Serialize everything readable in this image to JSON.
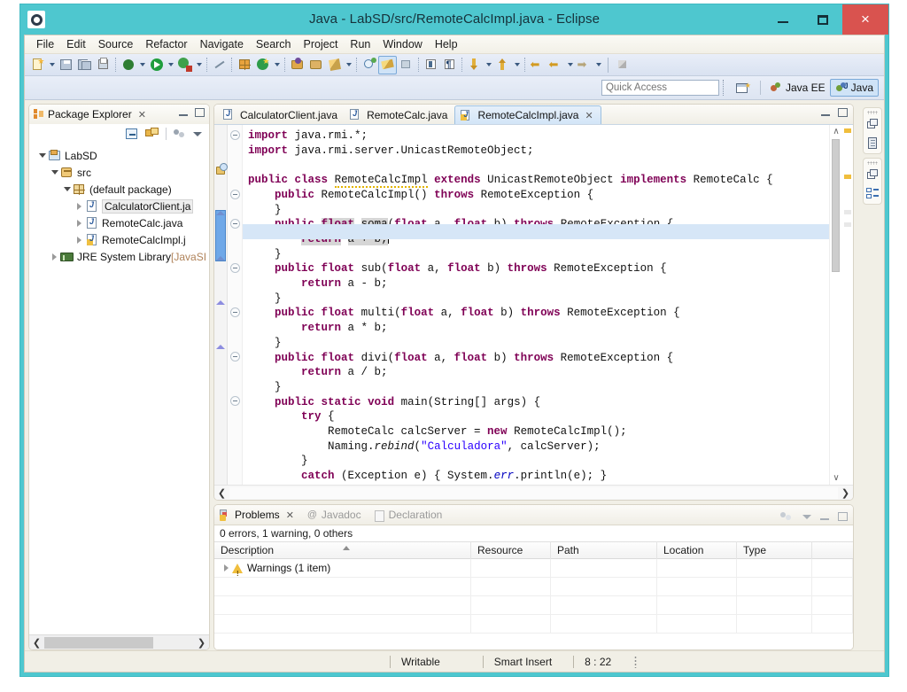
{
  "window": {
    "title": "Java - LabSD/src/RemoteCalcImpl.java - Eclipse",
    "logo_icon": "eclipse-logo-icon",
    "minimize_label": "Minimize",
    "maximize_label": "Maximize",
    "close_label": "×"
  },
  "menubar": {
    "items": [
      {
        "label": "File",
        "mnemonic": "F"
      },
      {
        "label": "Edit",
        "mnemonic": "E"
      },
      {
        "label": "Source",
        "mnemonic": "S"
      },
      {
        "label": "Refactor",
        "mnemonic": "t"
      },
      {
        "label": "Navigate",
        "mnemonic": "N"
      },
      {
        "label": "Search",
        "mnemonic": "a"
      },
      {
        "label": "Project",
        "mnemonic": "P"
      },
      {
        "label": "Run",
        "mnemonic": "R"
      },
      {
        "label": "Window",
        "mnemonic": "W"
      },
      {
        "label": "Help",
        "mnemonic": "H"
      }
    ]
  },
  "toolbar": {
    "items": [
      {
        "name": "new-wizard-button",
        "icon": "new-document-icon",
        "dropdown": true
      },
      {
        "name": "save-button",
        "icon": "save-icon",
        "dropdown": false
      },
      {
        "name": "save-all-button",
        "icon": "save-all-icon",
        "dropdown": false
      },
      {
        "name": "print-button",
        "icon": "print-icon",
        "dropdown": false
      },
      {
        "name": "debug-button",
        "icon": "debug-bug-icon",
        "dropdown": true
      },
      {
        "name": "run-button",
        "icon": "run-play-icon",
        "dropdown": true
      },
      {
        "name": "coverage-button",
        "icon": "coverage-icon",
        "dropdown": true
      },
      {
        "name": "skip-breakpoints-button",
        "icon": "skip-breakpoints-icon",
        "dropdown": false
      },
      {
        "name": "new-java-project-button",
        "icon": "new-java-project-icon",
        "dropdown": false
      },
      {
        "name": "new-class-button",
        "icon": "new-class-icon",
        "dropdown": true
      },
      {
        "name": "open-type-button",
        "icon": "open-type-icon",
        "dropdown": false
      },
      {
        "name": "open-task-button",
        "icon": "open-task-icon",
        "dropdown": false
      },
      {
        "name": "quick-fix-button",
        "icon": "quick-fix-pencil-icon",
        "dropdown": true
      },
      {
        "name": "search-button",
        "icon": "search-globe-icon",
        "dropdown": false
      },
      {
        "name": "toggle-mark-occurrences-button",
        "icon": "highlighter-icon",
        "dropdown": false,
        "selected": true
      },
      {
        "name": "link-editor-button",
        "icon": "link-editor-icon",
        "dropdown": false
      },
      {
        "name": "toggle-block-selection-button",
        "icon": "block-selection-icon",
        "dropdown": false
      },
      {
        "name": "show-whitespace-button",
        "icon": "pilcrow-icon",
        "dropdown": false
      },
      {
        "name": "next-annotation-button",
        "icon": "next-annotation-icon",
        "dropdown": true
      },
      {
        "name": "previous-annotation-button",
        "icon": "previous-annotation-icon",
        "dropdown": true
      },
      {
        "name": "back-button",
        "icon": "back-arrow-icon",
        "dropdown": false
      },
      {
        "name": "forward-button",
        "icon": "forward-arrow-icon",
        "dropdown": true
      },
      {
        "name": "next-edit-button",
        "icon": "next-edit-arrow-icon",
        "dropdown": true
      },
      {
        "name": "pin-editor-button",
        "icon": "pin-editor-icon",
        "dropdown": false
      }
    ]
  },
  "quick_access": {
    "placeholder": "Quick Access",
    "value": "",
    "new_perspective_label": "Open Perspective",
    "perspectives": [
      {
        "label": "Java EE",
        "active": false,
        "icon": "java-ee-perspective-icon"
      },
      {
        "label": "Java",
        "active": true,
        "icon": "java-perspective-icon"
      }
    ]
  },
  "package_explorer": {
    "title": "Package Explorer",
    "close_glyph": "✕",
    "icon": "package-explorer-icon",
    "toolbar": [
      {
        "name": "collapse-all-button",
        "icon": "collapse-all-icon"
      },
      {
        "name": "link-with-editor-button",
        "icon": "link-with-editor-icon"
      },
      {
        "name": "focus-on-active-task-button",
        "icon": "focus-active-task-icon"
      },
      {
        "name": "view-menu-button",
        "icon": "view-menu-chevron-icon"
      }
    ],
    "minimize_label": "Minimize",
    "maximize_label": "Maximize",
    "tree": [
      {
        "label": "LabSD",
        "indent": 0,
        "twisty": "open",
        "icon": "java-project-icon",
        "selected": false
      },
      {
        "label": "src",
        "indent": 1,
        "twisty": "open",
        "icon": "source-folder-icon",
        "selected": false
      },
      {
        "label": "(default package)",
        "indent": 2,
        "twisty": "open",
        "icon": "package-icon",
        "selected": false
      },
      {
        "label": "CalculatorClient.ja",
        "indent": 3,
        "twisty": "closed",
        "icon": "java-file-icon",
        "selected": true
      },
      {
        "label": "RemoteCalc.java",
        "indent": 3,
        "twisty": "closed",
        "icon": "java-file-icon",
        "selected": false
      },
      {
        "label": "RemoteCalcImpl.j",
        "indent": 3,
        "twisty": "closed",
        "icon": "java-file-warning-icon",
        "selected": false
      },
      {
        "label": "JRE System Library ",
        "sublabel": "[JavaSI",
        "indent": 1,
        "twisty": "closed",
        "icon": "jre-library-icon",
        "selected": false
      }
    ],
    "hscroll": {
      "left_glyph": "❮",
      "right_glyph": "❯"
    }
  },
  "editor": {
    "tabs": [
      {
        "label": "CalculatorClient.java",
        "active": false,
        "icon": "java-file-icon",
        "closeable": false
      },
      {
        "label": "RemoteCalc.java",
        "active": false,
        "icon": "java-file-icon",
        "closeable": false
      },
      {
        "label": "RemoteCalcImpl.java",
        "active": true,
        "icon": "java-file-warning-icon",
        "closeable": true,
        "close_glyph": "✕"
      }
    ],
    "minimize_label": "Minimize",
    "maximize_label": "Maximize",
    "scroll_up_glyph": "∧",
    "scroll_down_glyph": "∨",
    "hscroll": {
      "left_glyph": "❮",
      "right_glyph": "❯"
    },
    "code_lines": [
      "import java.rmi.*;",
      "import java.rmi.server.UnicastRemoteObject;",
      "",
      "public class RemoteCalcImpl extends UnicastRemoteObject implements RemoteCalc {",
      "    public RemoteCalcImpl() throws RemoteException {",
      "    }",
      "    public float soma(float a, float b) throws RemoteException {",
      "        return a + b;",
      "    }",
      "    public float sub(float a, float b) throws RemoteException {",
      "        return a - b;",
      "    }",
      "    public float multi(float a, float b) throws RemoteException {",
      "        return a * b;",
      "    }",
      "    public float divi(float a, float b) throws RemoteException {",
      "        return a / b;",
      "    }",
      "    public static void main(String[] args) {",
      "        try {",
      "            RemoteCalc calcServer = new RemoteCalcImpl();",
      "            Naming.rebind(\"Calculadora\", calcServer);",
      "        }",
      "        catch (Exception e) { System.err.println(e); }",
      "    }"
    ]
  },
  "problems": {
    "tabs": [
      {
        "label": "Problems",
        "active": true,
        "icon": "problems-icon",
        "closeable": true,
        "close_glyph": "✕"
      },
      {
        "label": "Javadoc",
        "active": false,
        "icon": "javadoc-icon",
        "closeable": false
      },
      {
        "label": "Declaration",
        "active": false,
        "icon": "declaration-icon",
        "closeable": false
      }
    ],
    "toolbar": [
      {
        "name": "filters-button",
        "icon": "filters-icon"
      },
      {
        "name": "view-menu-button",
        "icon": "view-menu-chevron-icon"
      },
      {
        "name": "minimize-button",
        "icon": "minimize-icon"
      },
      {
        "name": "maximize-button",
        "icon": "maximize-icon"
      }
    ],
    "summary": "0 errors, 1 warning, 0 others",
    "columns": [
      "Description",
      "Resource",
      "Path",
      "Location",
      "Type"
    ],
    "rows": [
      {
        "description": "Warnings (1 item)",
        "icon": "warning-icon",
        "twisty": "closed",
        "resource": "",
        "path": "",
        "location": "",
        "type": ""
      },
      {
        "description": "",
        "icon": "",
        "twisty": "",
        "resource": "",
        "path": "",
        "location": "",
        "type": ""
      },
      {
        "description": "",
        "icon": "",
        "twisty": "",
        "resource": "",
        "path": "",
        "location": "",
        "type": ""
      },
      {
        "description": "",
        "icon": "",
        "twisty": "",
        "resource": "",
        "path": "",
        "location": "",
        "type": ""
      }
    ]
  },
  "fastview": {
    "groups": [
      {
        "items": [
          {
            "name": "restore-views-button",
            "icon": "restore-stack-icon"
          },
          {
            "name": "package-explorer-fastview-button",
            "icon": "package-explorer-mini-icon"
          }
        ]
      },
      {
        "items": [
          {
            "name": "restore-views-button-2",
            "icon": "restore-stack-icon"
          },
          {
            "name": "outline-fastview-button",
            "icon": "outline-icon"
          }
        ]
      }
    ]
  },
  "statusbar": {
    "writable": "Writable",
    "insert_mode": "Smart Insert",
    "position": "8 : 22"
  },
  "colors": {
    "titlebar": "#4ec7cf",
    "close_button": "#d9534f",
    "keyword": "#7f0055",
    "string": "#2a00ff",
    "field": "#0000c0",
    "caret_line": "#d6e6f7",
    "occurrence_highlight": "#d6d6d6",
    "selection": "#cfe3f7",
    "warning": "#f0be3c"
  }
}
